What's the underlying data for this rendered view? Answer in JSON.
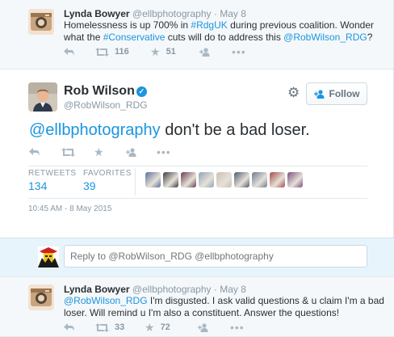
{
  "tweets": [
    {
      "author_name": "Lynda Bowyer",
      "author_handle": "@ellbphotography",
      "dot": "·",
      "time": "May 8",
      "text_parts": {
        "p1": "Homelessness is up 700% in ",
        "tag1": "#RdgUK",
        "p2": " during previous coalition. Wonder what the ",
        "tag2": "#Conservative",
        "p3": " cuts will do to address this ",
        "mention": "@RobWilson_RDG",
        "p4": "?"
      },
      "retweet_count": "116",
      "favorite_count": "51"
    }
  ],
  "main_tweet": {
    "author_name": "Rob Wilson",
    "verified_glyph": "✓",
    "author_handle": "@RobWilson_RDG",
    "follow_label": "Follow",
    "text_mention": "@ellbphotography",
    "text_rest": " don't be a bad loser.",
    "retweets_label": "RETWEETS",
    "retweets_value": "134",
    "favorites_label": "FAVORITES",
    "favorites_value": "39",
    "timestamp": "10:45 AM - 8 May 2015",
    "favoriter_avatar_colors": [
      "#5b6f9a",
      "#3d3a3f",
      "#6a3a52",
      "#8fa3b5",
      "#c9c1b3",
      "#4f5c6b",
      "#6b7d8d",
      "#a34a4a",
      "#7a4d7e"
    ]
  },
  "reply_box": {
    "placeholder": "Reply to @RobWilson_RDG @ellbphotography"
  },
  "reply_tweet": {
    "author_name": "Lynda Bowyer",
    "author_handle": "@ellbphotography",
    "dot": "·",
    "time": "May 8",
    "mention": "@RobWilson_RDG",
    "text_line1": " I'm disgusted. I ask valid questions & u claim I'm a bad",
    "text_line2": "loser. Will remind u I'm also a constituent. Answer the questions!",
    "retweet_count": "33",
    "favorite_count": "72"
  },
  "icons": {
    "reply": "reply-icon",
    "retweet": "retweet-icon",
    "favorite": "star-icon",
    "follow": "follow-person-icon",
    "more": "more-dots-icon",
    "gear": "gear-icon"
  },
  "colors": {
    "link": "#1b95e0",
    "meta": "#8899a6",
    "action_icon": "#aab8c2",
    "reply_area": "#e8f4fb"
  }
}
